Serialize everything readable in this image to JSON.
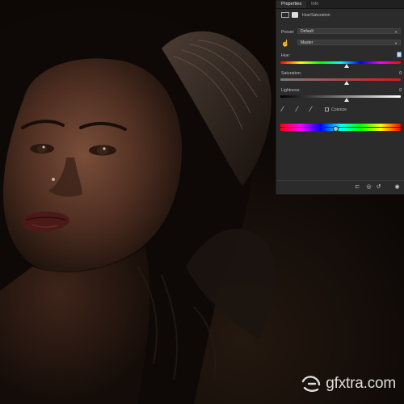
{
  "panel": {
    "tabs": [
      {
        "label": "Properties"
      },
      {
        "label": "Info"
      }
    ],
    "adjustment_title": "Hue/Saturation",
    "preset_label": "Preset:",
    "preset_value": "Default",
    "channel_value": "Master",
    "hue": {
      "label": "Hue:",
      "value": "0"
    },
    "saturation": {
      "label": "Saturation:",
      "value": "0"
    },
    "lightness": {
      "label": "Lightness:",
      "value": "0"
    },
    "colorize_label": "Colorize"
  },
  "watermark": {
    "text": "gfxtra.com"
  },
  "colors": {
    "panel_bg": "#2b2b2b",
    "accent": "#4a90d9"
  }
}
